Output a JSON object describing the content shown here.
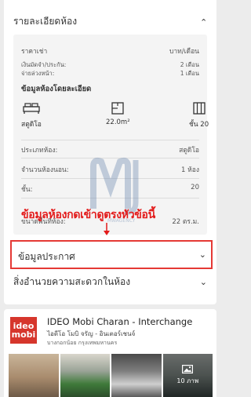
{
  "room_details": {
    "title": "รายละเอียดห้อง",
    "rent_label": "ราคาเช่า",
    "rent_value": "บาท/เดือน",
    "deposit_label": "เงินมัดจำ/ประกัน:",
    "deposit_value": "2 เดือน",
    "advance_label": "จ่ายล่วงหน้า:",
    "advance_value": "1 เดือน",
    "summary_title": "ข้อมูลห้องโดยละเอียด",
    "summary_icons": [
      {
        "icon": "bed-icon",
        "label": "สตูดิโอ"
      },
      {
        "icon": "floor-plan-icon",
        "label": "22.0m²"
      },
      {
        "icon": "building-icon",
        "label": "ชั้น 20"
      }
    ],
    "rows": [
      {
        "label": "ประเภทห้อง:",
        "value": "สตูดิโอ"
      },
      {
        "label": "จำนวนห้องนอน:",
        "value": "1 ห้อง"
      },
      {
        "label": "ชั้น:",
        "value": "20"
      },
      {
        "label": "ขนาดพื้นที่ห้อง:",
        "value": "22 ตร.ม."
      }
    ]
  },
  "annotation": {
    "text": "ข้อมูลห้องกดเข้าดูตรงหัวข้อนี้",
    "color": "#e31b1b"
  },
  "watermark": {
    "text": "MWAGENCY"
  },
  "announcement": {
    "title": "ข้อมูลประกาศ"
  },
  "amenities": {
    "title": "สิ่งอำนวยความสะดวกในห้อง"
  },
  "listing": {
    "logo_line1": "ideo",
    "logo_line2": "mobi",
    "title_en": "IDEO Mobi Charan - Interchange",
    "title_th": "ไอดีโอ โมบิ จรัญ - อินเตอร์เชนจ์",
    "location": "บางกอกน้อย กรุงเทพมหานคร",
    "photo_count": "10 ภาพ"
  }
}
